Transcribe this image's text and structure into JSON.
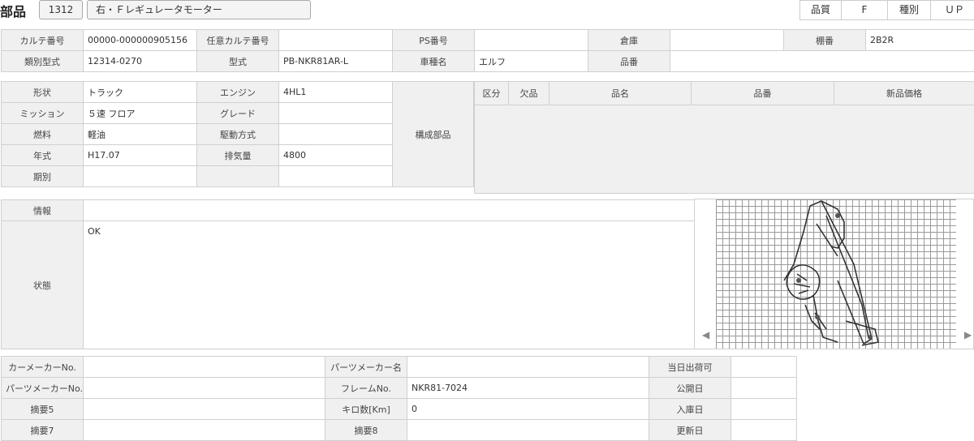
{
  "header": {
    "title": "部品",
    "code": "1312",
    "name": "右・Ｆレギュレータモーター",
    "quality_label": "品質",
    "quality_value": "F",
    "type_label": "種別",
    "type_value": "ＵＰ"
  },
  "info1": {
    "karte_label": "カルテ番号",
    "karte_value": "00000-000000905156",
    "nini_label": "任意カルテ番号",
    "nini_value": "",
    "ps_label": "PS番号",
    "ps_value": "",
    "souko_label": "倉庫",
    "souko_value": "",
    "tana_label": "棚番",
    "tana_value": "2B2R",
    "ruibetsu_label": "類別型式",
    "ruibetsu_value": "12314-0270",
    "katashiki_label": "型式",
    "katashiki_value": "PB-NKR81AR-L",
    "shashu_label": "車種名",
    "shashu_value": "エルフ",
    "hinban_label": "品番",
    "hinban_value": ""
  },
  "specs": {
    "keijou_label": "形状",
    "keijou_value": "トラック",
    "engine_label": "エンジン",
    "engine_value": "4HL1",
    "mission_label": "ミッション",
    "mission_value": "５速 フロア",
    "grade_label": "グレード",
    "grade_value": "",
    "nenryo_label": "燃料",
    "nenryo_value": "軽油",
    "kudou_label": "駆動方式",
    "kudou_value": "",
    "nenshiki_label": "年式",
    "nenshiki_value": "H17.07",
    "haiki_label": "排気量",
    "haiki_value": "4800",
    "kibetsu_label": "期別",
    "kibetsu_value": "",
    "kousei_label": "構成部品"
  },
  "parts_table": {
    "headers": [
      "区分",
      "欠品",
      "品名",
      "品番",
      "新品価格"
    ]
  },
  "notes": {
    "jouhou_label": "情報",
    "jouhou_value": "",
    "joutai_label": "状態",
    "joutai_value": "OK"
  },
  "image": {
    "subject": "window-regulator-motor sketch on grid"
  },
  "info2": {
    "car_maker_no_label": "カーメーカーNo.",
    "car_maker_no_value": "",
    "parts_maker_name_label": "パーツメーカー名",
    "parts_maker_name_value": "",
    "touzitsu_label": "当日出荷可",
    "touzitsu_value": "",
    "parts_maker_no_label": "パーツメーカーNo.",
    "parts_maker_no_value": "",
    "frame_label": "フレームNo.",
    "frame_value": "NKR81-7024",
    "koukai_label": "公開日",
    "koukai_value": "",
    "tekiyou5_label": "摘要5",
    "tekiyou5_value": "",
    "kiro_label": "キロ数[Km]",
    "kiro_value": "0",
    "nyuuko_label": "入庫日",
    "nyuuko_value": "",
    "tekiyou7_label": "摘要7",
    "tekiyou7_value": "",
    "tekiyou8_label": "摘要8",
    "tekiyou8_value": "",
    "koushin_label": "更新日",
    "koushin_value": ""
  }
}
